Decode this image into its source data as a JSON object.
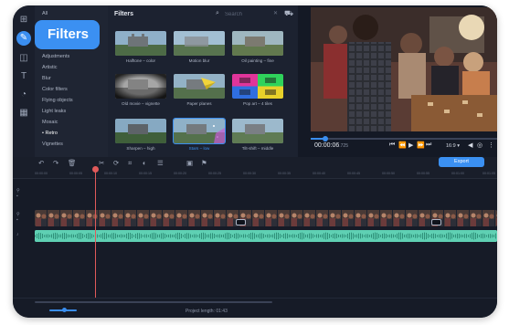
{
  "callout": {
    "label": "Filters"
  },
  "categories": {
    "items": [
      "All",
      "Adjustments",
      "Artistic",
      "Blur",
      "Color filters",
      "Flying objects",
      "Light leaks",
      "Mosaic",
      "Retro",
      "Vignettes"
    ],
    "selected": "Retro"
  },
  "filters_panel": {
    "title": "Filters",
    "search_placeholder": "Search",
    "tiles": [
      {
        "label": "Halftone – color"
      },
      {
        "label": "Motion blur"
      },
      {
        "label": "Oil painting – fine"
      },
      {
        "label": "Old movie – vignette"
      },
      {
        "label": "Paper planes"
      },
      {
        "label": "Pop art – 4 tiles"
      },
      {
        "label": "Sharpen – high"
      },
      {
        "label": "Stars – low"
      },
      {
        "label": "Tilt-shift – middle"
      }
    ],
    "selected_tile": "Stars – low"
  },
  "player": {
    "timecode_current": "00:00:06",
    "timecode_fraction": "725",
    "scrub_progress": 0.08,
    "ratio": "16:9"
  },
  "toolbar": {
    "export_label": "Export"
  },
  "ruler": {
    "ticks": [
      "00:00:00",
      "00:00:05",
      "00:00:10",
      "00:00:15",
      "00:00:20",
      "00:00:25",
      "00:00:30",
      "00:00:35",
      "00:00:40",
      "00:00:45",
      "00:00:50",
      "00:00:55",
      "00:01:00",
      "00:01:05"
    ]
  },
  "status": {
    "project_length": "Project length: 01:43"
  },
  "colors": {
    "accent": "#3b90f2",
    "playhead": "#e05a5a",
    "audio": "#5fd0b3"
  }
}
